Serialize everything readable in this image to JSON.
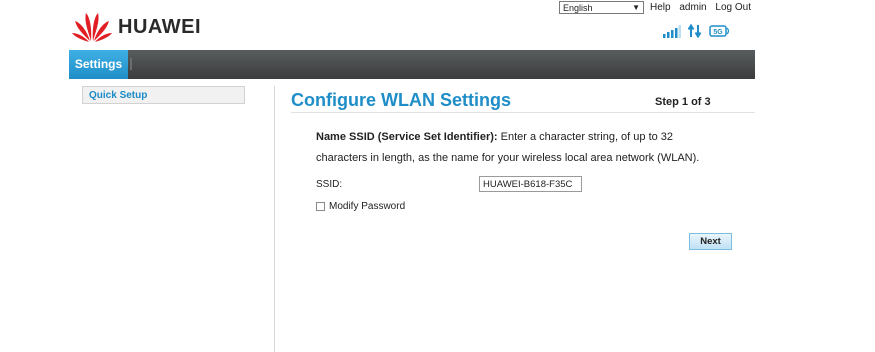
{
  "header": {
    "brand": "HUAWEI",
    "language": {
      "selected": "English"
    },
    "links": {
      "help": "Help",
      "user": "admin",
      "logout": "Log Out"
    },
    "status_icons": [
      "signal-bars-icon",
      "data-arrows-icon",
      "4g-network-icon"
    ],
    "network_badge": "5G"
  },
  "nav": {
    "tab": "Settings"
  },
  "sidebar": {
    "items": [
      {
        "label": "Quick Setup"
      }
    ]
  },
  "main": {
    "title": "Configure WLAN Settings",
    "step": "Step 1 of 3",
    "description_bold": "Name SSID (Service Set Identifier):",
    "description_text": "  Enter a character string, of up to 32 characters in length, as the name for your wireless local area network (WLAN).",
    "ssid_label": "SSID:",
    "ssid_value": "HUAWEI-B618-F35C",
    "modify_password_label": "Modify Password",
    "modify_password_checked": false,
    "next_label": "Next"
  },
  "colors": {
    "accent": "#1f8ec8",
    "navbar": "#3a3c3d",
    "logo_red": "#e21e25"
  }
}
